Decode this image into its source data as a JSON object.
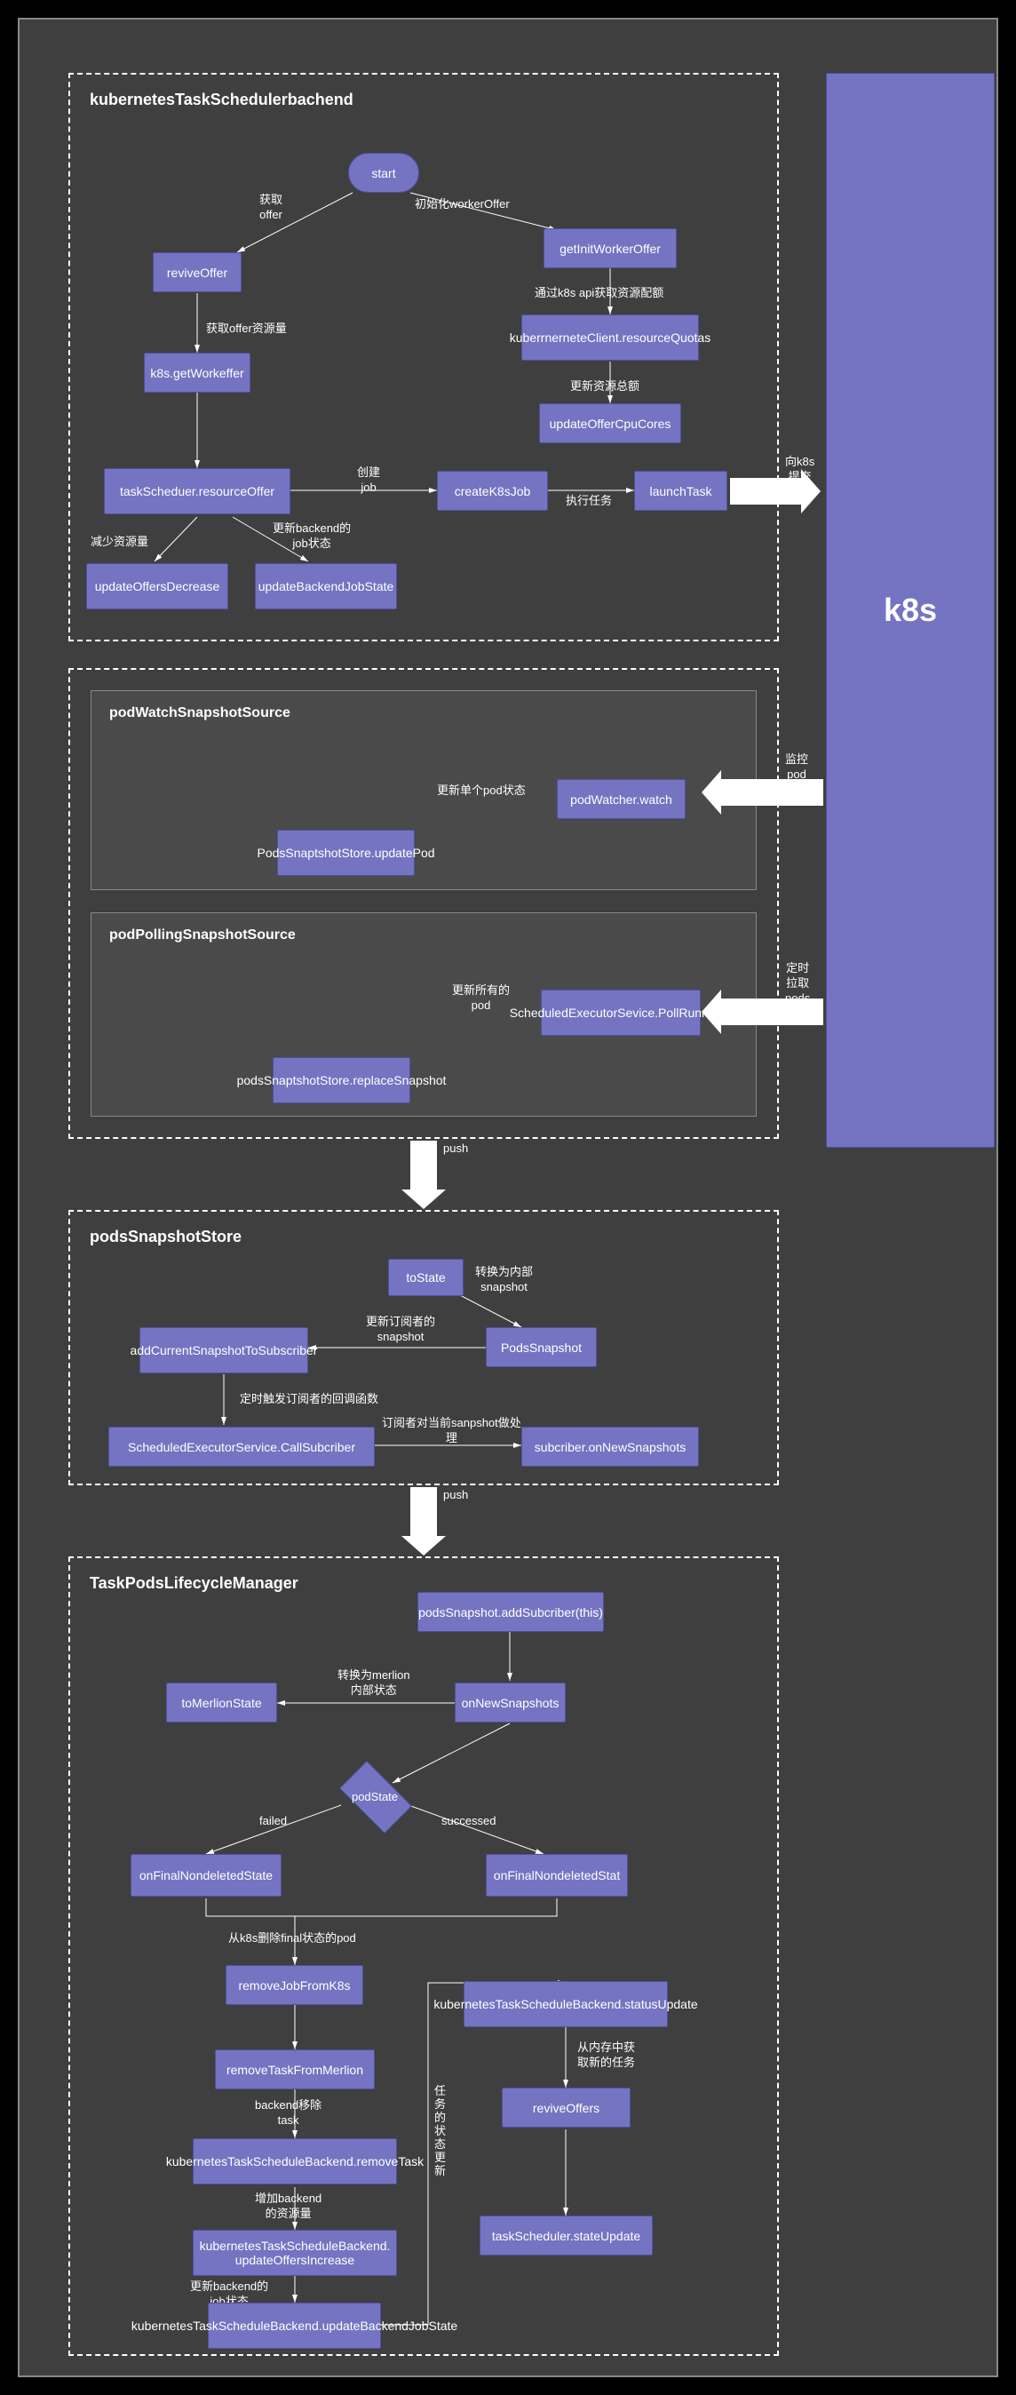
{
  "groups": {
    "g1": {
      "title": "kubernetesTaskSchedulerbachend"
    },
    "g2_outer": "",
    "g2a": {
      "title": "podWatchSnapshotSource"
    },
    "g2b": {
      "title": "podPollingSnapshotSource"
    },
    "g3": {
      "title": "podsSnapshotStore"
    },
    "g4": {
      "title": "TaskPodsLifecycleManager"
    }
  },
  "nodes": {
    "start": "start",
    "getInitWorkerOffer": "getInitWorkerOffer",
    "reviveOffer": "reviveOffer",
    "resourceQuotas": "kuberrnerneteClient.resourceQuotas",
    "getWorkeffer": "k8s.getWorkeffer",
    "updateOfferCpuCores": "updateOfferCpuCores",
    "taskScheduerResourceOffer": "taskScheduer.resourceOffer",
    "createK8sJob": "createK8sJob",
    "launchTask": "launchTask",
    "updateOffersDecrease": "updateOffersDecrease",
    "updateBackendJobState": "updateBackendJobState",
    "k8s": "k8s",
    "podWatcherWatch": "podWatcher.watch",
    "updatePod": "PodsSnaptshotStore.updatePod",
    "scheduledPollRunnable": "ScheduledExecutorSevice.PollRunnable",
    "replaceSnapshot": "podsSnaptshotStore.replaceSnapshot",
    "toState": "toState",
    "podsSnapshot": "PodsSnapshot",
    "addCurrentSnapshot": "addCurrentSnapshotToSubscriber",
    "callSubscriber": "ScheduledExecutorService.CallSubcriber",
    "subscriberOnNew": "subcriber.onNewSnapshots",
    "addSubscriber": "podsSnapshot.addSubcriber(this)",
    "onNewSnapshots": "onNewSnapshots",
    "toMerlionState": "toMerlionState",
    "podState": "podState",
    "onFinalLeft": "onFinalNondeletedState",
    "onFinalRight": "onFinalNondeletedStat",
    "removeJobFromK8s": "removeJobFromK8s",
    "removeTaskFromMerlion": "removeTaskFromMerlion",
    "backendRemoveTask": "kubernetesTaskScheduleBackend.removeTask",
    "backendUpdateOffersIncrease": "kubernetesTaskScheduleBackend. updateOffersIncrease",
    "backendUpdateJobState": "kubernetesTaskScheduleBackend.updateBackendJobState",
    "backendStatusUpdate": "kubernetesTaskScheduleBackend.statusUpdate",
    "reviveOffers": "reviveOffers",
    "taskSchedulerStateUpdate": "taskScheduler.stateUpdate"
  },
  "labels": {
    "l_getOffer": "获取\noffer",
    "l_initWorkerOffer": "初始化workerOffer",
    "l_k8sApiQuota": "通过k8s api获取资源配额",
    "l_updateTotalRes": "更新资源总额",
    "l_getOfferRes": "获取offer资源量",
    "l_createJob": "创建\njob",
    "l_execTask": "执行任务",
    "l_updateBackendJob": "更新backend的\njob状态",
    "l_decreaseRes": "减少资源量",
    "l_submitToK8s": "向k8s\n提交\n任务",
    "l_monitorPod": "监控\npod\n状态",
    "l_updateSinglePod": "更新单个pod状态",
    "l_pollPods": "定时\n拉取\npods\n状态",
    "l_updateAllPod": "更新所有的\npod",
    "l_push1": "push",
    "l_toInternalSnapshot": "转换为内部\nsnapshot",
    "l_updateSubscriberSnapshot": "更新订阅者的\nsnapshot",
    "l_triggerCallback": "定时触发订阅者的回调函数",
    "l_subscriberHandle": "订阅者对当前sanpshot做处\n理",
    "l_push2": "push",
    "l_toMerlionInternal": "转换为merlion\n内部状态",
    "l_failed": "failed",
    "l_successed": "successed",
    "l_removeFinalPod": "从k8s删除final状态的pod",
    "l_backendRemoveTask": "backend移除\ntask",
    "l_increaseBackendRes": "增加backend\n的资源量",
    "l_updateBackendJob2": "更新backend的\njob状态",
    "l_taskStatusUpdate": "任\n务\n的\n状\n态\n更\n新",
    "l_getNewTaskFromMem": "从内存中获\n取新的任务"
  }
}
